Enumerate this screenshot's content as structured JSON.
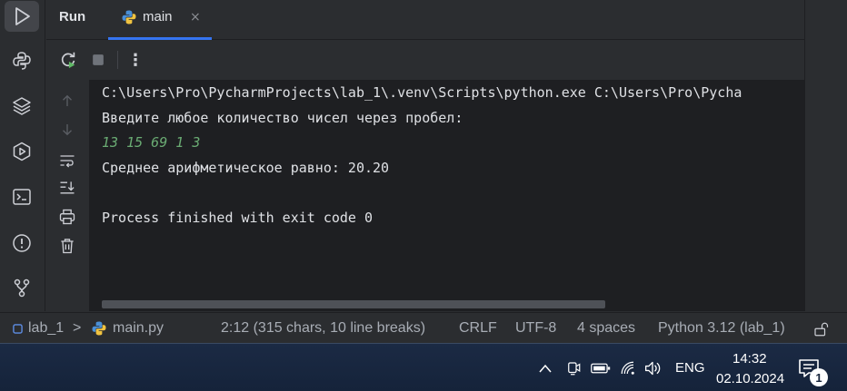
{
  "header": {
    "run_label": "Run",
    "tab_label": "main",
    "tab_close": "×"
  },
  "toolbar": {
    "more_label": "⋮"
  },
  "console": {
    "lines": [
      "C:\\Users\\Pro\\PycharmProjects\\lab_1\\.venv\\Scripts\\python.exe C:\\Users\\Pro\\Pycha",
      "Введите любое количество чисел через пробел:",
      "13 15 69 1 3",
      "Среднее арифметическое равно: 20.20",
      "Process finished with exit code 0"
    ]
  },
  "status": {
    "project": "lab_1",
    "separator": ">",
    "file": "main.py",
    "position": "2:12 (315 chars, 10 line breaks)",
    "line_ending": "CRLF",
    "encoding": "UTF-8",
    "indent": "4 spaces",
    "interpreter": "Python 3.12 (lab_1)"
  },
  "taskbar": {
    "language": "ENG",
    "time": "14:32",
    "date": "02.10.2024",
    "notification_count": "1"
  },
  "colors": {
    "accent": "#3574f0",
    "run_green": "#5fb865",
    "input_green": "#6aab73",
    "console_bg": "#1e1f22"
  }
}
